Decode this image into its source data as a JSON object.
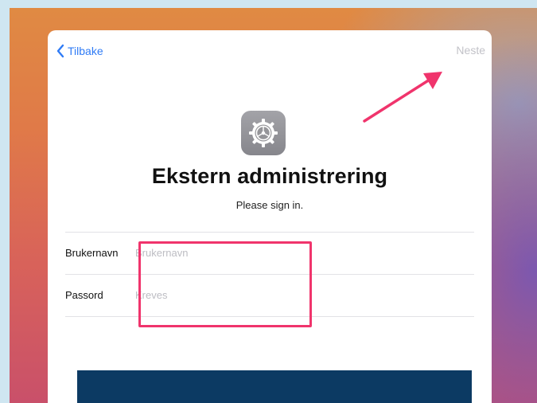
{
  "nav": {
    "back_label": "Tilbake",
    "next_label": "Neste"
  },
  "header": {
    "icon": "gear-icon",
    "title": "Ekstern administrering",
    "subtitle": "Please sign in."
  },
  "form": {
    "username": {
      "label": "Brukernavn",
      "value": "",
      "placeholder": "Brukernavn"
    },
    "password": {
      "label": "Passord",
      "value": "",
      "placeholder": "Kreves"
    }
  },
  "annotations": {
    "highlight_color": "#f0346c",
    "arrow_color": "#f0346c"
  },
  "colors": {
    "accent": "#2f7bf5",
    "caption_bg": "#0c3a63"
  }
}
